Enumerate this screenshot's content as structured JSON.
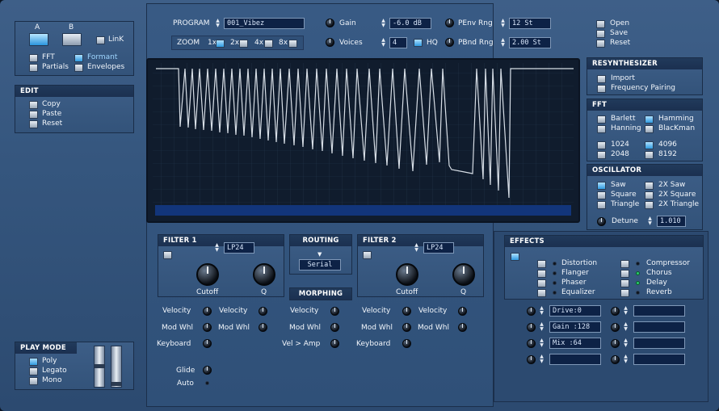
{
  "ab": {
    "a_label": "A",
    "b_label": "B",
    "link_label": "LinK"
  },
  "view": {
    "fft": "FFT",
    "formant": "Formant",
    "partials": "Partials",
    "envelopes": "Envelopes"
  },
  "edit": {
    "title": "EDIT",
    "copy": "Copy",
    "paste": "Paste",
    "reset": "Reset"
  },
  "play_mode": {
    "title": "PLAY MODE",
    "poly": "Poly",
    "legato": "Legato",
    "mono": "Mono"
  },
  "top": {
    "program_label": "PROGRAM",
    "program_value": "001_Vibez",
    "zoom_label": "ZOOM",
    "zoom_1x": "1x",
    "zoom_2x": "2x",
    "zoom_4x": "4x",
    "zoom_8x": "8x",
    "gain_label": "Gain",
    "gain_value": "-6.0 dB",
    "voices_label": "Voices",
    "voices_value": "4",
    "hq_label": "HQ",
    "penv_label": "PEnv Rng",
    "penv_value": "12 St",
    "pbnd_label": "PBnd Rng",
    "pbnd_value": "2.00 St"
  },
  "file": {
    "open": "Open",
    "save": "Save",
    "reset": "Reset"
  },
  "resynth": {
    "title": "RESYNTHESIZER",
    "import": "Import",
    "freq_pairing": "Frequency Pairing"
  },
  "fft": {
    "title": "FFT",
    "bartlett": "Barlett",
    "hamming": "Hamming",
    "hanning": "Hanning",
    "blackman": "BlacKman",
    "s1024": "1024",
    "s4096": "4096",
    "s2048": "2048",
    "s8192": "8192"
  },
  "osc": {
    "title": "OSCILLATOR",
    "saw": "Saw",
    "saw2x": "2X Saw",
    "square": "Square",
    "square2x": "2X Square",
    "triangle": "Triangle",
    "triangle2x": "2X Triangle",
    "detune_label": "Detune",
    "detune_value": "1.010"
  },
  "filter1": {
    "title": "FILTER 1",
    "type": "LP24",
    "cutoff": "Cutoff",
    "q": "Q",
    "velocity": "Velocity",
    "velocity_q": "Velocity",
    "modwhl": "Mod Whl",
    "modwhl_q": "Mod Whl",
    "keyboard": "Keyboard",
    "glide": "Glide",
    "auto": "Auto"
  },
  "routing": {
    "title": "ROUTING",
    "value": "Serial"
  },
  "morphing": {
    "title": "MORPHING",
    "velocity": "Velocity",
    "modwhl": "Mod Whl",
    "vel_amp": "Vel > Amp"
  },
  "filter2": {
    "title": "FILTER 2",
    "type": "LP24",
    "cutoff": "Cutoff",
    "q": "Q",
    "velocity": "Velocity",
    "velocity_q": "Velocity",
    "modwhl": "Mod Whl",
    "modwhl_q": "Mod Whl",
    "keyboard": "Keyboard"
  },
  "effects": {
    "title": "EFFECTS",
    "distortion": "Distortion",
    "compressor": "Compressor",
    "flanger": "Flanger",
    "chorus": "Chorus",
    "phaser": "Phaser",
    "delay": "Delay",
    "equalizer": "Equalizer",
    "reverb": "Reverb",
    "param1": "Drive:0",
    "param2": "Gain :128",
    "param3": "Mix  :64",
    "param4": "",
    "param5": "",
    "param6": "",
    "param7": "",
    "param8": ""
  }
}
